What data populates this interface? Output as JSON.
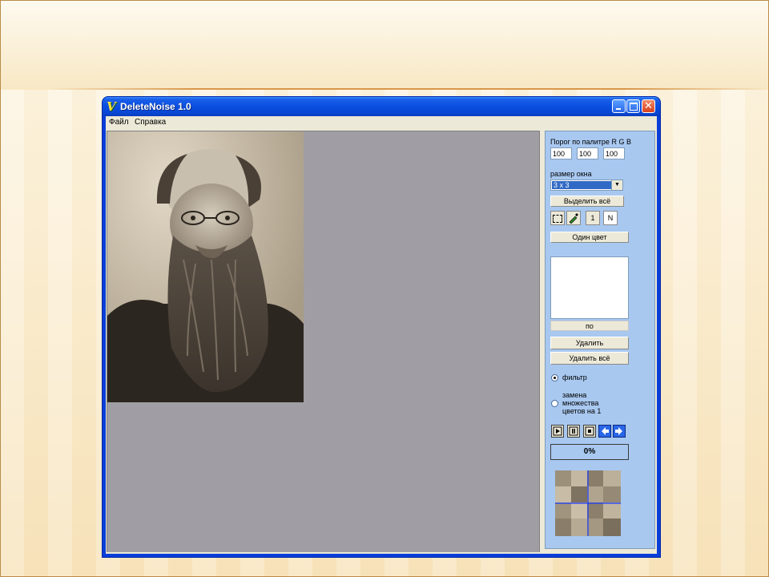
{
  "window": {
    "title": "DeleteNoise 1.0",
    "icon": "app-logo-icon",
    "controls": {
      "minimize": "minimize-icon",
      "maximize": "maximize-icon",
      "close": "✕"
    }
  },
  "menu": [
    {
      "label": "Файл"
    },
    {
      "label": "Справка"
    }
  ],
  "panel": {
    "threshold_label": "Порог по палитре R G B",
    "rgb": [
      "100",
      "100",
      "100"
    ],
    "window_size_label": "размер окна",
    "window_size_value": "3 x 3",
    "select_all_label": "Выделить всё",
    "tools": {
      "select": "rect-select-icon",
      "pick": "eyedropper-icon",
      "one": "1",
      "n": "N"
    },
    "one_color_label": "Один цвет",
    "list_caption": "по",
    "delete_label": "Удалить",
    "delete_all_label": "Удалить всё",
    "mode_filter_label": "фильтр",
    "mode_replace_label": "замена множества цветов на 1",
    "mode_selected": "filter",
    "media": [
      "play-icon",
      "pause-icon",
      "stop-icon",
      "back-arrow-icon",
      "forward-arrow-icon"
    ],
    "progress_text": "0%",
    "progress_value": 0
  },
  "colors": {
    "titlebar": "#0a4ee0",
    "panel_bg": "#a8c8f0",
    "canvas_bg": "#a09ea4"
  }
}
